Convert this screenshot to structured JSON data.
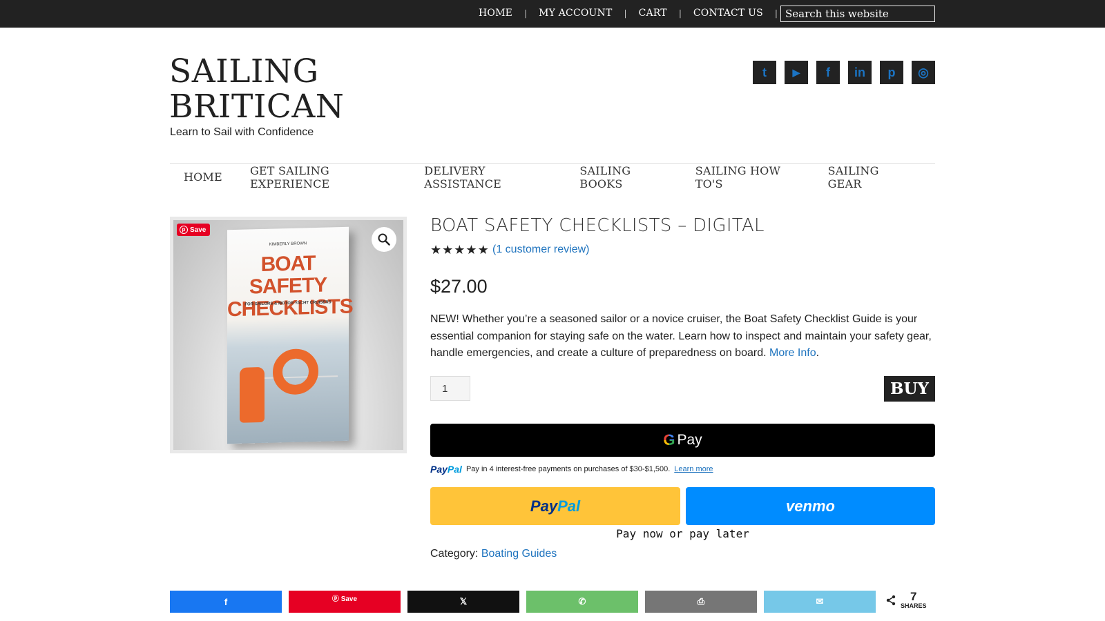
{
  "topnav": {
    "items": [
      "HOME",
      "MY ACCOUNT",
      "CART",
      "CONTACT US"
    ],
    "search_placeholder": "Search this website"
  },
  "header": {
    "title_line1": "SAILING",
    "title_line2": "BRITICAN",
    "tagline": "Learn to Sail with Confidence",
    "social_icons": [
      "twitter-icon",
      "youtube-icon",
      "facebook-icon",
      "linkedin-icon",
      "pinterest-icon",
      "instagram-icon"
    ],
    "social_glyphs": [
      "t",
      "▶",
      "f",
      "in",
      "p",
      "◎"
    ]
  },
  "mainnav": {
    "items": [
      "HOME",
      "GET SAILING EXPERIENCE",
      "DELIVERY ASSISTANCE",
      "SAILING BOOKS",
      "SAILING HOW TO'S",
      "SAILING GEAR"
    ]
  },
  "product_image": {
    "save_label": "Save",
    "book_author": "KIMBERLY BROWN",
    "book_title_line1": "BOAT SAFETY",
    "book_title_line2": "CHECKLISTS",
    "book_subtitle": "FOR SAILORS & MOTOR YACHT CRUISERS"
  },
  "product": {
    "title": "BOAT SAFETY CHECKLISTS – DIGITAL",
    "rating": 5,
    "review_link": "(1 customer review)",
    "price": "$27.00",
    "description": "NEW! Whether you’re a seasoned sailor or a novice cruiser, the Boat Safety Checklist Guide is your essential companion for staying safe on the water. Learn how to inspect and maintain your safety gear, handle emergencies, and create a culture of preparedness on board.",
    "more_info": "More Info",
    "quantity": "1",
    "buy_label": "BUY",
    "category_label": "Category:",
    "category_link": "Boating Guides"
  },
  "payments": {
    "gpay_letter": "G",
    "gpay_text": "Pay",
    "paypal_logo_a": "Pay",
    "paypal_logo_b": "Pal",
    "paylater_msg": "Pay in 4 interest-free payments on purchases of $30-$1,500.",
    "learn_more": "Learn more",
    "paypal_btn_a": "Pay",
    "paypal_btn_b": "Pal",
    "venmo_label": "venmo",
    "pay_now_later": "Pay now or pay later"
  },
  "share": {
    "buttons": [
      {
        "name": "facebook",
        "glyph": "f",
        "label": ""
      },
      {
        "name": "pinterest",
        "glyph": "",
        "label": "Save"
      },
      {
        "name": "x",
        "glyph": "𝕏",
        "label": ""
      },
      {
        "name": "whatsapp",
        "glyph": "✆",
        "label": ""
      },
      {
        "name": "print",
        "glyph": "⎙",
        "label": ""
      },
      {
        "name": "email",
        "glyph": "✉",
        "label": ""
      }
    ],
    "count": "7",
    "count_label": "SHARES"
  }
}
